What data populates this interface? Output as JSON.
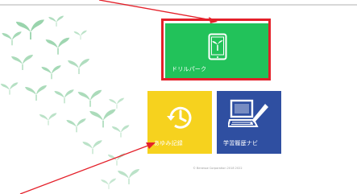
{
  "tiles": {
    "drill": {
      "label": "ドリルパーク"
    },
    "history": {
      "label": "あゆみ記録"
    },
    "navi": {
      "label": "学習履歴ナビ"
    }
  },
  "footer": {
    "copyright": "© Benesse Corporation 2018 2022"
  },
  "colors": {
    "drill_bg": "#22c25a",
    "history_bg": "#f6d21e",
    "navi_bg": "#2f4fa1",
    "highlight": "#e4202a",
    "annotation_arrow": "#e4202a",
    "sprout": "#8fd0a4"
  },
  "icons": {
    "drill": "tablet-sprout-icon",
    "history": "clock-history-icon",
    "navi": "computer-pen-icon",
    "background": "sprout-leaves-icon"
  }
}
